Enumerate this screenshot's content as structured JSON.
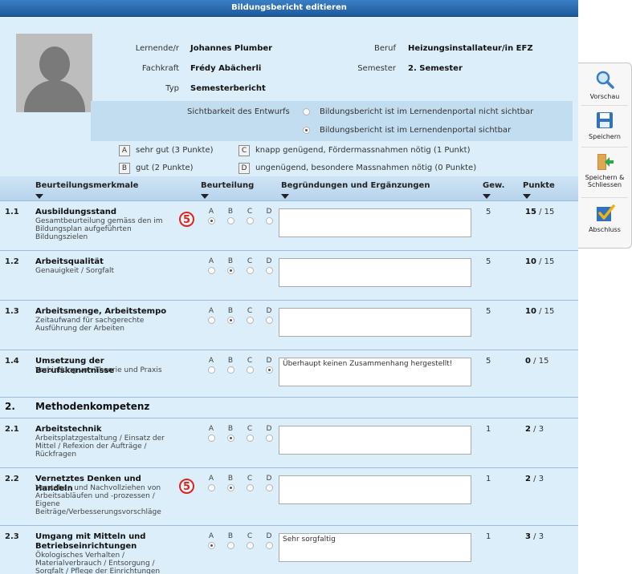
{
  "window": {
    "title": "Bildungsbericht editieren"
  },
  "info": {
    "lernende_label": "Lernende/r",
    "lernende_value": "Johannes Plumber",
    "beruf_label": "Beruf",
    "beruf_value": "Heizungsinstallateur/in EFZ",
    "fachkraft_label": "Fachkraft",
    "fachkraft_value": "Frédy Abächerli",
    "semester_label": "Semester",
    "semester_value": "2. Semester",
    "typ_label": "Typ",
    "typ_value": "Semesterbericht"
  },
  "visibility": {
    "label": "Sichtbarkeit des Entwurfs",
    "options": [
      {
        "text": "Bildungsbericht ist im Lernendenportal nicht sichtbar",
        "checked": false
      },
      {
        "text": "Bildungsbericht ist im Lernendenportal sichtbar",
        "checked": true
      }
    ]
  },
  "legend": {
    "a_key": "A",
    "a_text": "sehr gut (3 Punkte)",
    "b_key": "B",
    "b_text": "gut (2 Punkte)",
    "c_key": "C",
    "c_text": "knapp genügend, Fördermassnahmen nötig (1 Punkt)",
    "d_key": "D",
    "d_text": "ungenügend, besondere Massnahmen nötig (0 Punkte)"
  },
  "columns": {
    "merkmale": "Beurteilungsmerkmale",
    "beurteilung": "Beurteilung",
    "begruendungen": "Begründungen und Ergänzungen",
    "gew": "Gew.",
    "punkte": "Punkte"
  },
  "grade_letters": [
    "A",
    "B",
    "C",
    "D"
  ],
  "rows": [
    {
      "num": "1.1",
      "title": "Ausbildungsstand",
      "sub": "Gesamtbeurteilung gemäss den im Bildungsplan aufgeführten Bildungszielen",
      "selected": 0,
      "text": "",
      "gew": "5",
      "points": "15",
      "max": "/ 15",
      "badge": "5"
    },
    {
      "num": "1.2",
      "title": "Arbeitsqualität",
      "sub": "Genauigkeit / Sorgfalt",
      "selected": 1,
      "text": "",
      "gew": "5",
      "points": "10",
      "max": "/ 15"
    },
    {
      "num": "1.3",
      "title": "Arbeitsmenge, Arbeitstempo",
      "sub": "Zeitaufwand für sachgerechte Ausführung der Arbeiten",
      "selected": 1,
      "text": "",
      "gew": "5",
      "points": "10",
      "max": "/ 15"
    },
    {
      "num": "1.4",
      "title": "Umsetzung der Berufskenntnisse",
      "sub": "Verbindung von Theorie und Praxis",
      "selected": 3,
      "text": "Überhaupt keinen Zusammenhang hergestellt!",
      "gew": "5",
      "points": "0",
      "max": "/ 15"
    },
    {
      "num": "2.1",
      "title": "Arbeitstechnik",
      "sub": "Arbeitsplatzgestaltung / Einsatz der Mittel / Refexion der Aufträge / Rückfragen",
      "selected": 1,
      "text": "",
      "gew": "1",
      "points": "2",
      "max": "/ 3"
    },
    {
      "num": "2.2",
      "title": "Vernetztes Denken und Handeln",
      "sub": "Verstehen und Nachvollziehen von Arbeitsabläufen und -prozessen / Eigene Beiträge/Verbesserungsvorschläge",
      "selected": 1,
      "text": "",
      "gew": "1",
      "points": "2",
      "max": "/ 3",
      "badge": "5"
    },
    {
      "num": "2.3",
      "title": "Umgang mit Mitteln und Betriebseinrichtungen",
      "sub": "Ökologisches Verhalten / Materialverbrauch / Entsorgung / Sorgfalt / Pflege der Einrichtungen",
      "selected": 0,
      "text": "Sehr sorgfaltig",
      "gew": "1",
      "points": "3",
      "max": "/ 3"
    }
  ],
  "section2": {
    "num": "2.",
    "title": "Methodenkompetenz"
  },
  "sidebar": {
    "vorschau": "Vorschau",
    "speichern": "Speichern",
    "speichern_schliessen": "Speichern & Schliessen",
    "abschluss": "Abschluss"
  },
  "colors": {
    "panel": "#dbeefa",
    "titlebar": "#2a6cb0",
    "badge": "#e0231c"
  }
}
